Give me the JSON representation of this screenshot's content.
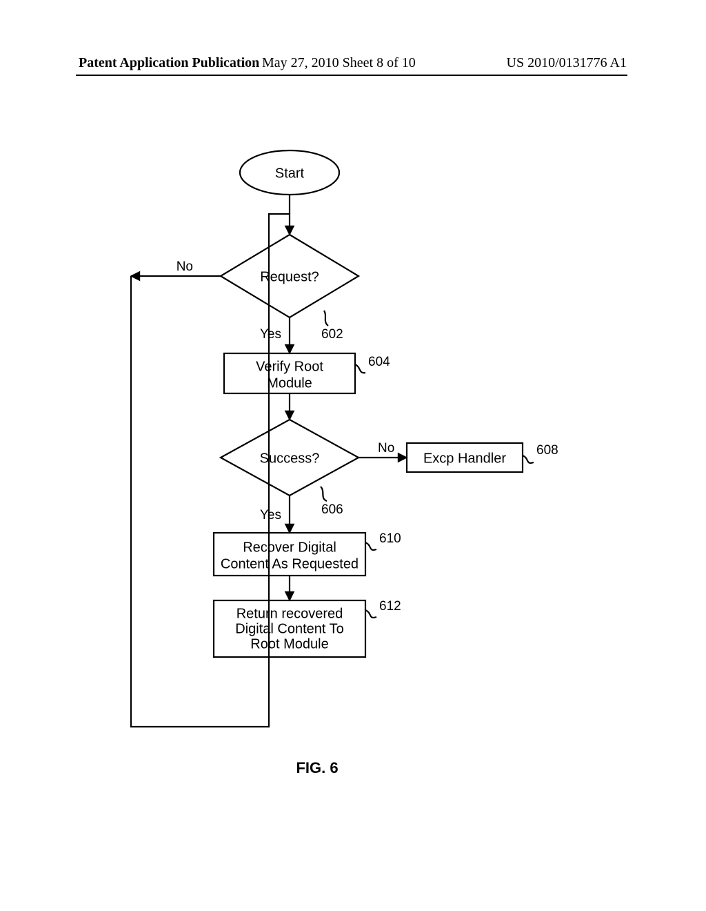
{
  "header": {
    "left": "Patent Application Publication",
    "mid": "May 27, 2010  Sheet 8 of 10",
    "right": "US 2010/0131776 A1"
  },
  "flow": {
    "start": "Start",
    "request": "Request?",
    "request_no": "No",
    "request_yes": "Yes",
    "verify": {
      "line1": "Verify Root",
      "line2": "Module",
      "ref": "604"
    },
    "request_ref": "602",
    "success": "Success?",
    "success_yes": "Yes",
    "success_no": "No",
    "success_ref": "606",
    "excp": {
      "text": "Excp Handler",
      "ref": "608"
    },
    "recover": {
      "line1": "Recover Digital",
      "line2": "Content As Requested",
      "ref": "610"
    },
    "return": {
      "line1": "Return recovered",
      "line2": "Digital Content To",
      "line3": "Root Module",
      "ref": "612"
    }
  },
  "figure_caption": "FIG. 6"
}
